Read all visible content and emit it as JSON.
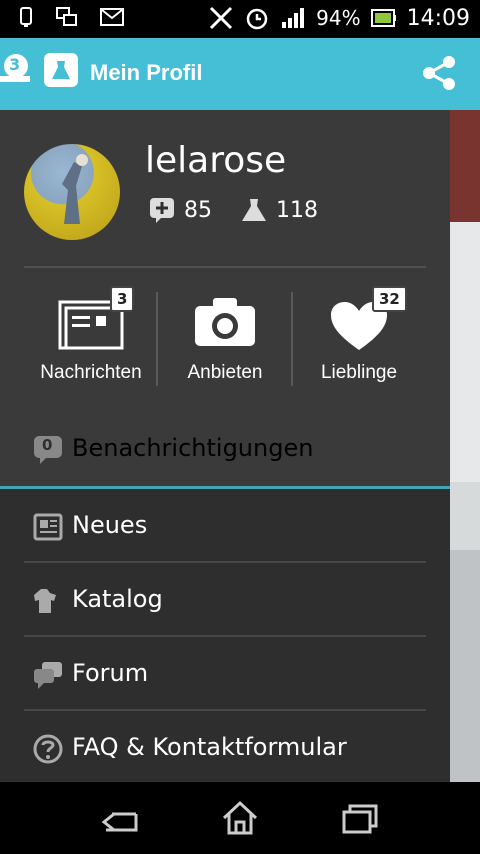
{
  "status_bar": {
    "battery": "94%",
    "time": "14:09"
  },
  "action_bar": {
    "badge_count": "3",
    "title": "Mein Profil"
  },
  "profile": {
    "username": "lelarose",
    "stat_bubbles": "85",
    "stat_items": "118"
  },
  "tiles": [
    {
      "label": "Nachrichten",
      "badge": "3"
    },
    {
      "label": "Anbieten"
    },
    {
      "label": "Lieblinge",
      "badge": "32"
    }
  ],
  "notifications": {
    "count": "0",
    "label": "Benachrichtigungen"
  },
  "menu": {
    "neues": "Neues",
    "katalog": "Katalog",
    "forum": "Forum",
    "faq": "FAQ & Kontaktformular"
  },
  "colors": {
    "accent": "#45bfd6",
    "drawer": "#2e2e2e",
    "drawer_header": "#3a3a3a",
    "divider_accent": "#45a3b6"
  }
}
